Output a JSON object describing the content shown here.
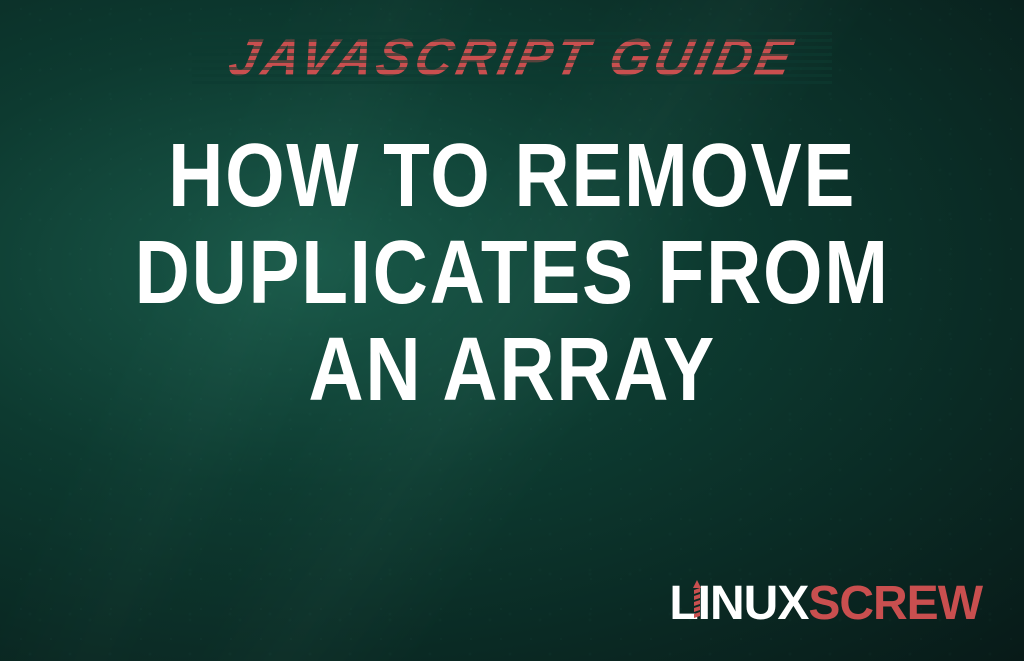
{
  "header": {
    "label": "JAVASCRIPT GUIDE"
  },
  "main": {
    "title_line1": "HOW TO REMOVE",
    "title_line2": "DUPLICATES FROM",
    "title_line3": "AN ARRAY"
  },
  "logo": {
    "part1": "LINUX",
    "part2": "SCREW"
  }
}
